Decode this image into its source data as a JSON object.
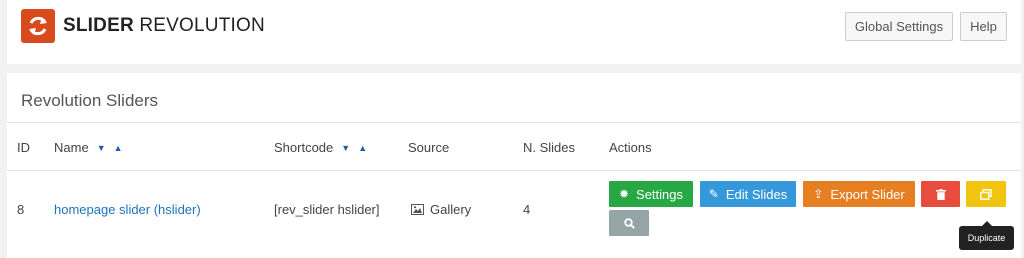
{
  "header": {
    "logo_bold": "SLIDER",
    "logo_light": " REVOLUTION",
    "global_settings_label": "Global Settings",
    "help_label": "Help"
  },
  "panel": {
    "title": "Revolution Sliders",
    "columns": {
      "id": "ID",
      "name": "Name",
      "shortcode": "Shortcode",
      "source": "Source",
      "slides": "N. Slides",
      "actions": "Actions"
    },
    "row": {
      "id": "8",
      "name": "homepage slider (hslider)",
      "shortcode": "[rev_slider hslider]",
      "source": "Gallery",
      "slides": "4"
    },
    "actions": {
      "settings": "Settings",
      "edit_slides": "Edit Slides",
      "export_slider": "Export Slider"
    },
    "tooltip": "Duplicate"
  },
  "colors": {
    "logo": "#d94a1c",
    "settings": "#27a844",
    "edit": "#3498db",
    "export": "#e67e22",
    "delete": "#e74c3c",
    "duplicate": "#f1c40f",
    "preview": "#95a5a6"
  },
  "icons": {
    "logo": "refresh-icon",
    "settings": "gear-icon",
    "edit": "pencil-icon",
    "export": "export-icon",
    "delete": "trash-icon",
    "duplicate": "duplicate-icon",
    "preview": "search-icon",
    "source": "image-icon",
    "sort_down": "caret-down-icon",
    "sort_up": "caret-up-icon"
  }
}
